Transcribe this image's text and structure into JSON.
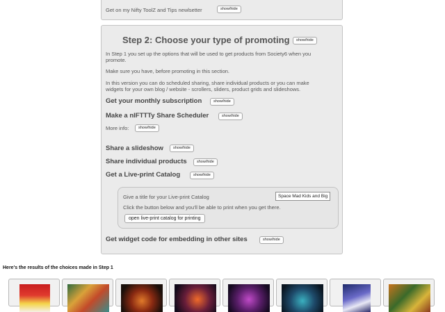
{
  "newsletter": {
    "text": "Get on my Nifty ToolZ and Tips newlsetter",
    "toggle": "show/hide"
  },
  "step2": {
    "title": "Step 2: Choose your type of promoting",
    "toggle": "show/hide",
    "intro1": "In Step 1 you set up the options that will be used to get products from Society6 when you",
    "intro1b": "promote.",
    "intro2": "Make sure you have, before promoting in this section.",
    "intro3": "In this version you can do scheduled sharing, share individual products or you can make",
    "intro3b": "widgets for your own blog / website - scrollers, sliders, product grids and slideshows.",
    "subscription": {
      "label": "Get your monthly subscription",
      "toggle": "show/hide"
    },
    "scheduler": {
      "label": "Make a nIFTTTy Share Scheduler",
      "toggle": "show/hide"
    },
    "more_info": {
      "label": "More info:",
      "toggle": "show/hide"
    },
    "slideshow": {
      "label": "Share a slideshow",
      "toggle": "show/hide"
    },
    "individual": {
      "label": "Share individual products",
      "toggle": "show/hide"
    },
    "catalog": {
      "label": "Get a Live-print Catalog",
      "toggle": "show/hide",
      "title_prompt": "Give a title for your Live-print Catalog",
      "title_value": "Space Mad Kids and Big",
      "instructions": "Click the button below and you'll be able to print when you get there.",
      "open_button": "open live-print catalog for printing"
    },
    "widget": {
      "label": "Get widget code for embedding in other sites",
      "toggle": "show/hide"
    }
  },
  "results": {
    "label": "Here's the results of the choices made in Step 1",
    "thumbnails": [
      {
        "name": "product-thumb-1"
      },
      {
        "name": "product-thumb-2"
      },
      {
        "name": "product-thumb-3"
      },
      {
        "name": "product-thumb-4"
      },
      {
        "name": "product-thumb-5"
      },
      {
        "name": "product-thumb-6"
      },
      {
        "name": "product-thumb-7"
      },
      {
        "name": "product-thumb-8"
      }
    ]
  }
}
